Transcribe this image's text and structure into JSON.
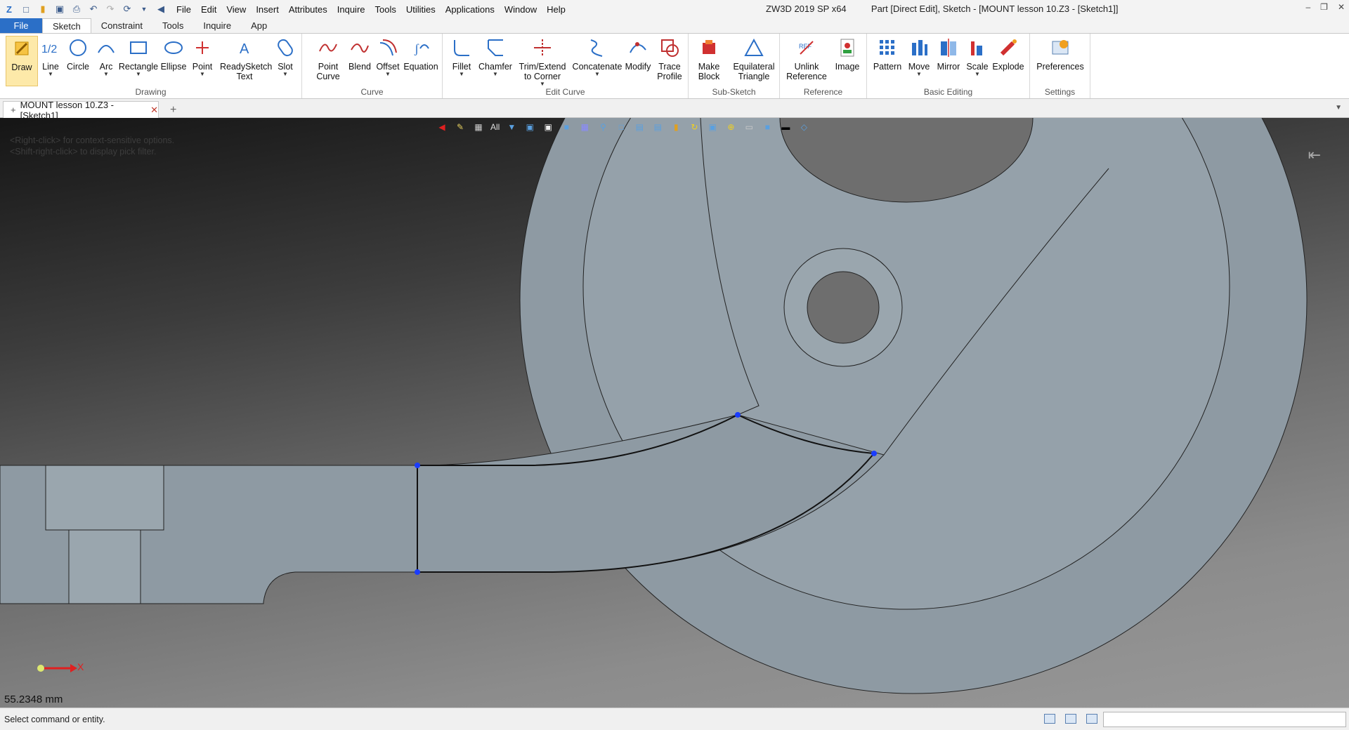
{
  "app": {
    "title": "ZW3D 2019 SP x64",
    "document_title": "Part [Direct Edit],  Sketch - [MOUNT lesson 10.Z3 - [Sketch1]]"
  },
  "menu": [
    "File",
    "Edit",
    "View",
    "Insert",
    "Attributes",
    "Inquire",
    "Tools",
    "Utilities",
    "Applications",
    "Window",
    "Help"
  ],
  "ribbon_tabs": [
    "File",
    "Sketch",
    "Constraint",
    "Tools",
    "Inquire",
    "App"
  ],
  "ribbon": {
    "drawing": {
      "label": "Drawing",
      "tools": [
        "Draw",
        "Line",
        "Circle",
        "Arc",
        "Rectangle",
        "Ellipse",
        "Point",
        "ReadySketch Text",
        "Slot"
      ]
    },
    "curve": {
      "label": "Curve",
      "tools": [
        "Point Curve",
        "Blend",
        "Offset",
        "Equation"
      ]
    },
    "edit_curve": {
      "label": "Edit Curve",
      "tools": [
        "Fillet",
        "Chamfer",
        "Trim/Extend to Corner",
        "Concatenate",
        "Modify",
        "Trace Profile"
      ]
    },
    "sub_sketch": {
      "label": "Sub-Sketch",
      "tools": [
        "Make Block",
        "Equilateral Triangle"
      ]
    },
    "reference": {
      "label": "Reference",
      "tools": [
        "Unlink Reference",
        "Image"
      ]
    },
    "basic_editing": {
      "label": "Basic Editing",
      "tools": [
        "Pattern",
        "Move",
        "Mirror",
        "Scale",
        "Explode"
      ]
    },
    "settings": {
      "label": "Settings",
      "tools": [
        "Preferences"
      ]
    }
  },
  "doc_tab": {
    "label": "MOUNT lesson 10.Z3 - [Sketch1]"
  },
  "viewport": {
    "hint_line1": "<Right-click> for context-sensitive options.",
    "hint_line2": "<Shift-right-click> to display pick filter.",
    "filter_label": "All",
    "measurement": "55.2348 mm",
    "axis_label": "X"
  },
  "status": {
    "text": "Select command or entity."
  },
  "colors": {
    "accent": "#2b6fc7",
    "point": "#1a3cff",
    "part": "#8e9aa3"
  }
}
